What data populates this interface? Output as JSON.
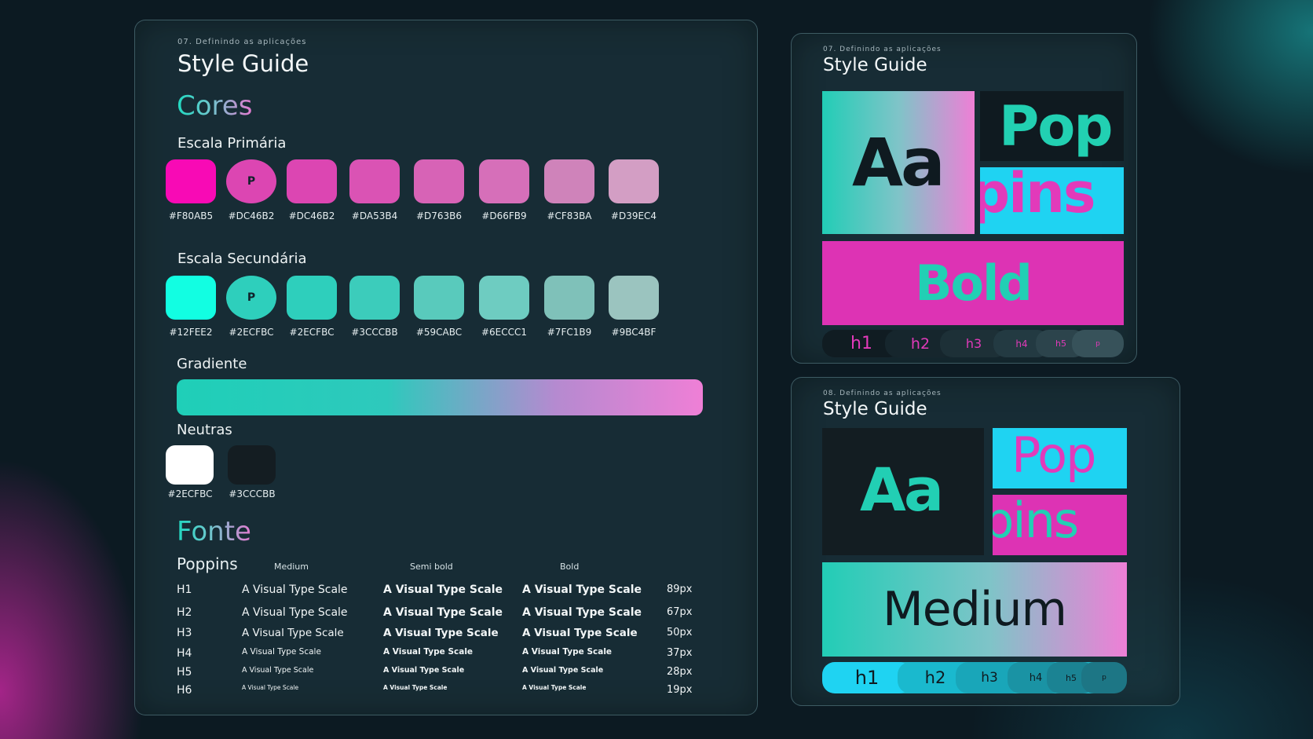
{
  "colors": {
    "primary": [
      "#F80AB5",
      "#DC46B2",
      "#DC46B2",
      "#DA53B4",
      "#D763B6",
      "#D66FB9",
      "#CF83BA",
      "#D39EC4"
    ],
    "secondary": [
      "#12FEE2",
      "#2ECFBC",
      "#2ECFBC",
      "#3CCCBB",
      "#59CABC",
      "#6ECCC1",
      "#7FC1B9",
      "#9BC4BF"
    ]
  },
  "main": {
    "eyebrow": "07. Definindo as aplicações",
    "title": "Style Guide",
    "cores": "Cores",
    "escala_primaria": "Escala Primária",
    "escala_secundaria": "Escala Secundária",
    "primary_swatches": [
      {
        "hex": "#F80AB5",
        "marker": ""
      },
      {
        "hex": "#DC46B2",
        "marker": "P"
      },
      {
        "hex": "#DC46B2",
        "marker": ""
      },
      {
        "hex": "#DA53B4",
        "marker": ""
      },
      {
        "hex": "#D763B6",
        "marker": ""
      },
      {
        "hex": "#D66FB9",
        "marker": ""
      },
      {
        "hex": "#CF83BA",
        "marker": ""
      },
      {
        "hex": "#D39EC4",
        "marker": ""
      }
    ],
    "secondary_swatches": [
      {
        "hex": "#12FEE2",
        "marker": ""
      },
      {
        "hex": "#2ECFBC",
        "marker": "P"
      },
      {
        "hex": "#2ECFBC",
        "marker": ""
      },
      {
        "hex": "#3CCCBB",
        "marker": ""
      },
      {
        "hex": "#59CABC",
        "marker": ""
      },
      {
        "hex": "#6ECCC1",
        "marker": ""
      },
      {
        "hex": "#7FC1B9",
        "marker": ""
      },
      {
        "hex": "#9BC4BF",
        "marker": ""
      }
    ],
    "gradiente": "Gradiente",
    "neutras": "Neutras",
    "neutral_swatches": [
      {
        "hex": "#2ECFBC",
        "color": "#ffffff"
      },
      {
        "hex": "#3CCCBB",
        "color": "#141d22"
      }
    ],
    "fonte": "Fonte",
    "font_name": "Poppins",
    "weights": [
      "Medium",
      "Semi bold",
      "Bold"
    ],
    "type_rows": [
      {
        "tag": "H1",
        "sample": "A Visual Type Scale",
        "size": "89px"
      },
      {
        "tag": "H2",
        "sample": "A Visual Type Scale",
        "size": "67px"
      },
      {
        "tag": "H3",
        "sample": "A Visual Type Scale",
        "size": "50px"
      },
      {
        "tag": "H4",
        "sample": "A Visual Type Scale",
        "size": "37px"
      },
      {
        "tag": "H5",
        "sample": "A Visual Type Scale",
        "size": "28px"
      },
      {
        "tag": "H6",
        "sample": "A Visual Type Scale",
        "size": "19px"
      }
    ]
  },
  "card_bold": {
    "eyebrow": "07. Definindo as aplicações",
    "title": "Style Guide",
    "aa": "Aa",
    "pop": "Pop",
    "pins": "pins",
    "weight": "Bold",
    "headings": [
      "h1",
      "h2",
      "h3",
      "h4",
      "h5",
      "p"
    ]
  },
  "card_medium": {
    "eyebrow": "08. Definindo as aplicações",
    "title": "Style Guide",
    "aa": "Aa",
    "pop": "Pop",
    "pins": "pins",
    "weight": "Medium",
    "headings": [
      "h1",
      "h2",
      "h3",
      "h4",
      "h5",
      "p"
    ]
  }
}
